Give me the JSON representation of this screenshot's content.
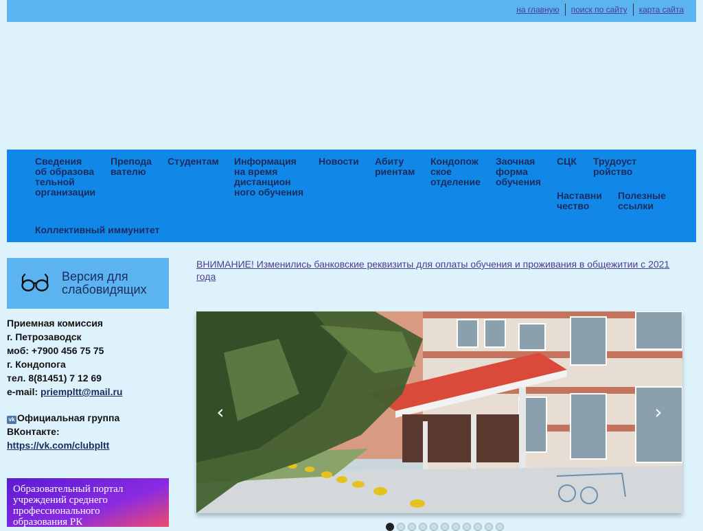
{
  "top_links": {
    "home": "на главную",
    "search": "поиск по сайту",
    "sitemap": "карта сайта"
  },
  "nav": {
    "items": [
      "Сведения\nоб образова\nтельной\nорганизации",
      "Препода\nвателю",
      "Студентам",
      "Информация\nна время\nдистанцион\nного обучения",
      "Новости",
      "Абиту\nриентам",
      "Кондопож\nское\nотделение",
      "Заочная\nформа\nобучения",
      "СЦК",
      "Трудоуст\nройство",
      "Наставни\nчество",
      "Полезные\nссылки",
      "Коллективный иммунитет"
    ]
  },
  "low_vision": {
    "label": "Версия для\nслабовидящих",
    "icon": "glasses-icon"
  },
  "contacts": {
    "title": "Приемная комиссия",
    "city1": "г. Петрозаводск",
    "mobile": "моб: +7900 456 75 75",
    "city2": "г. Кондопога",
    "phone": "тел. 8(81451) 7 12 69",
    "email_label": "e-mail: ",
    "email": "priempltt@mail.ru",
    "vk_text_1": "Официальная группа",
    "vk_text_2": "ВКонтакте:",
    "vk_link": "https://vk.com/clubpltt",
    "vk_icon": "vk-logo-icon"
  },
  "portal_banner": {
    "text": "Образовательный портал\nучреждений среднего\nпрофессионального\nобразования РК"
  },
  "notice": "ВНИМАНИЕ! Изменились банковские реквизиты для оплаты обучения и проживания в общежитии с 2021 года",
  "slider": {
    "prev": "‹",
    "next": "›",
    "dot_count": 11,
    "active_dot": 0
  },
  "colors": {
    "background": "#def2fc",
    "top_bar": "#5bb4f0",
    "nav_bar": "#1188e8",
    "nav_text": "#1b2b5e",
    "link": "#4a3d8f"
  }
}
